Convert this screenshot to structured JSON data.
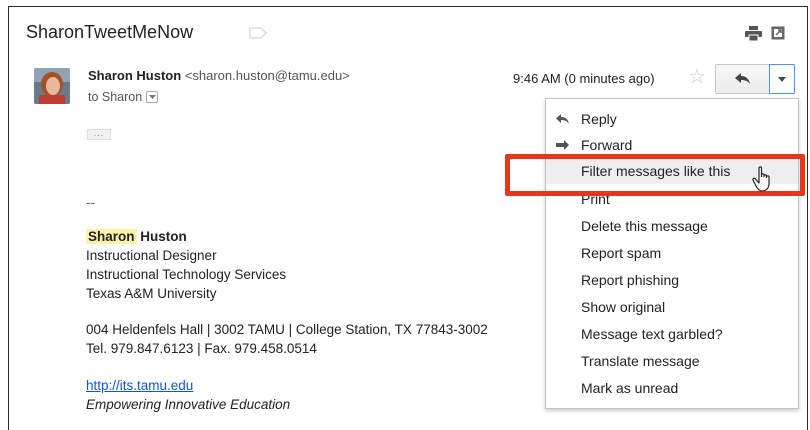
{
  "header": {
    "subject": "SharonTweetMeNow"
  },
  "message": {
    "sender_name": "Sharon Huston",
    "sender_email": "<sharon.huston@tamu.edu>",
    "to_label": "to Sharon",
    "timestamp": "9:46 AM (0 minutes ago)",
    "expander": "..."
  },
  "signature": {
    "dash": "--",
    "first_name": "Sharon",
    "last_name": "Huston",
    "title": "Instructional Designer",
    "department": "Instructional Technology Services",
    "university": "Texas A&M University",
    "address": "004 Heldenfels Hall | 3002 TAMU | College Station, TX 77843-3002",
    "phone": "Tel. 979.847.6123 | Fax. 979.458.0514",
    "link": "http://its.tamu.edu",
    "motto": "Empowering Innovative Education"
  },
  "menu": {
    "items": [
      {
        "label": "Reply",
        "icon": "reply-icon"
      },
      {
        "label": "Forward",
        "icon": "forward-icon"
      },
      {
        "label": "Filter messages like this",
        "state": "hovered"
      },
      {
        "label": "Print"
      },
      {
        "label": "Delete this message"
      },
      {
        "label": "Report spam"
      },
      {
        "label": "Report phishing"
      },
      {
        "label": "Show original"
      },
      {
        "label": "Message text garbled?"
      },
      {
        "label": "Translate message"
      },
      {
        "label": "Mark as unread"
      }
    ]
  },
  "colors": {
    "highlight_box": "#e8351c",
    "name_highlight": "#fdf2aa",
    "link": "#1155cc",
    "menu_hover": "#eeeeee"
  }
}
